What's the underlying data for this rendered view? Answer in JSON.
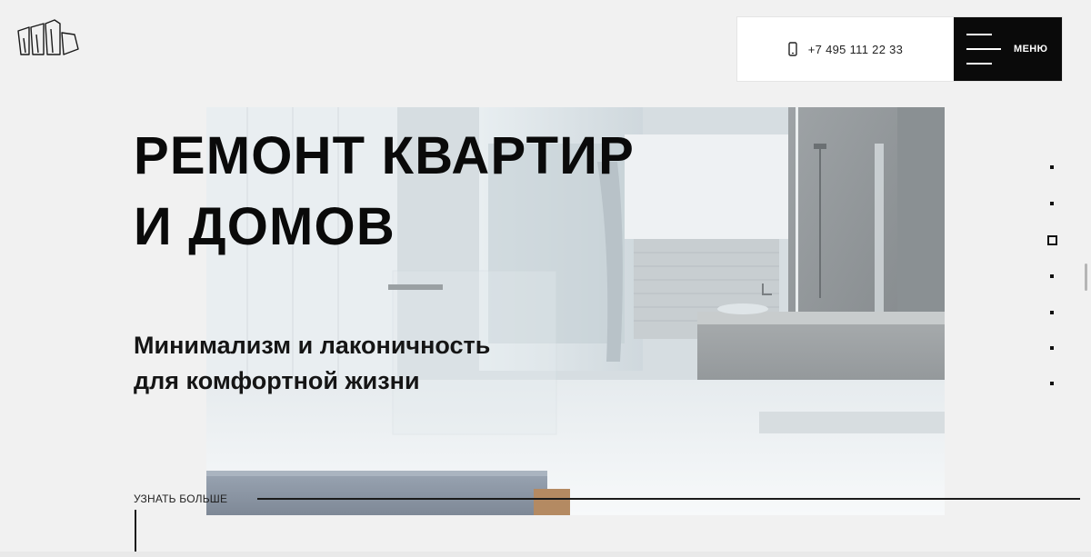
{
  "header": {
    "logo_icon": "building-outline-icon",
    "phone": "+7 495 111 22 33",
    "phone_icon": "mobile-phone-icon",
    "menu_label": "МЕНЮ",
    "menu_icon": "hamburger-icon"
  },
  "hero": {
    "title_lines": [
      "РЕМОНТ КВАРТИР",
      "И ДОМОВ"
    ],
    "subtitle_lines": [
      "Минимализм и лаконичность",
      "для комфортной жизни"
    ],
    "more_label": "УЗНАТЬ БОЛЬШЕ",
    "image": "minimalist-bathroom-interior-photo"
  },
  "pagination": {
    "total": 7,
    "active_index": 2
  },
  "colors": {
    "background": "#f1f1f1",
    "text": "#0a0a0a",
    "menu_bg": "#0a0a0a",
    "phone_bg": "#ffffff"
  }
}
